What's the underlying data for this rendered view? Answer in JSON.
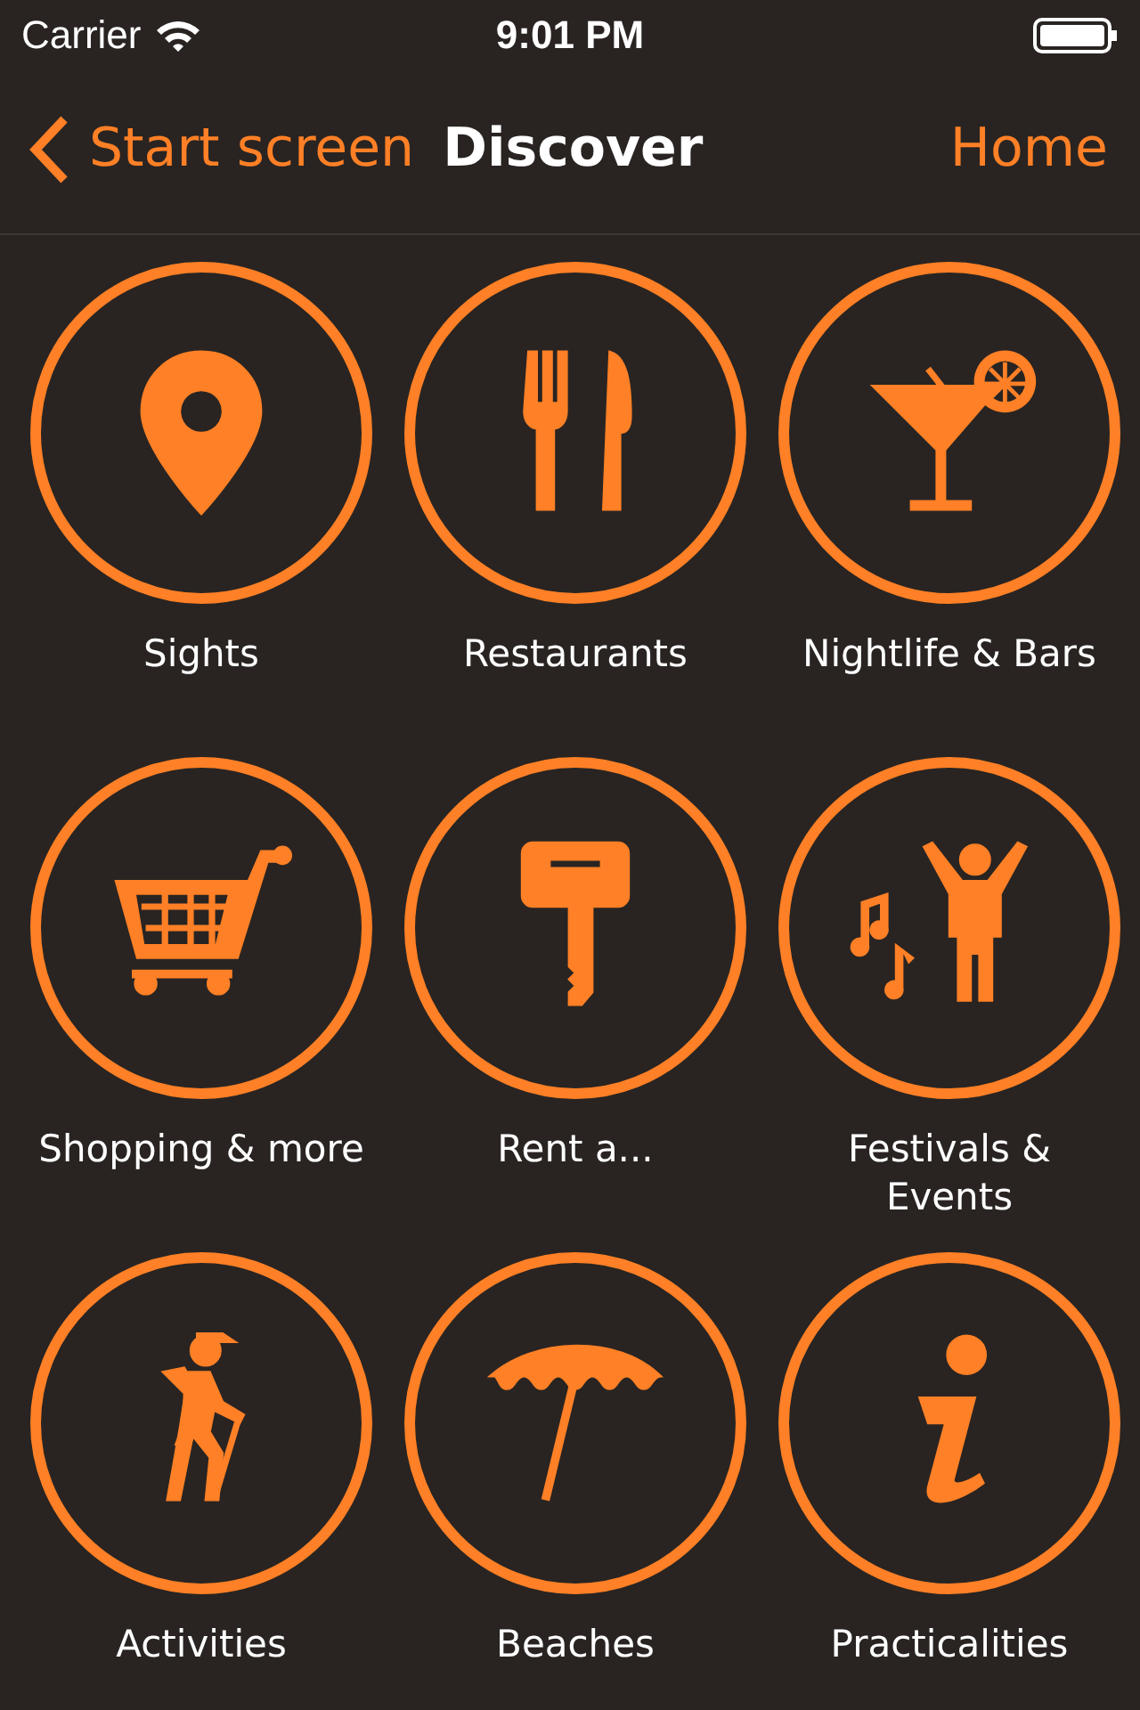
{
  "status_bar": {
    "carrier": "Carrier",
    "time": "9:01 PM"
  },
  "nav_bar": {
    "back_label": "Start screen",
    "title": "Discover",
    "right_button": "Home"
  },
  "categories": [
    {
      "label": "Sights",
      "kind": "pin"
    },
    {
      "label": "Restaurants",
      "kind": "cutlery"
    },
    {
      "label": "Nightlife & Bars",
      "kind": "cocktail"
    },
    {
      "label": "Shopping & more",
      "kind": "cart"
    },
    {
      "label": "Rent a...",
      "kind": "key"
    },
    {
      "label": "Festivals & Events",
      "kind": "festival"
    },
    {
      "label": "Activities",
      "kind": "hiker"
    },
    {
      "label": "Beaches",
      "kind": "umbrella"
    },
    {
      "label": "Practicalities",
      "kind": "info"
    }
  ]
}
